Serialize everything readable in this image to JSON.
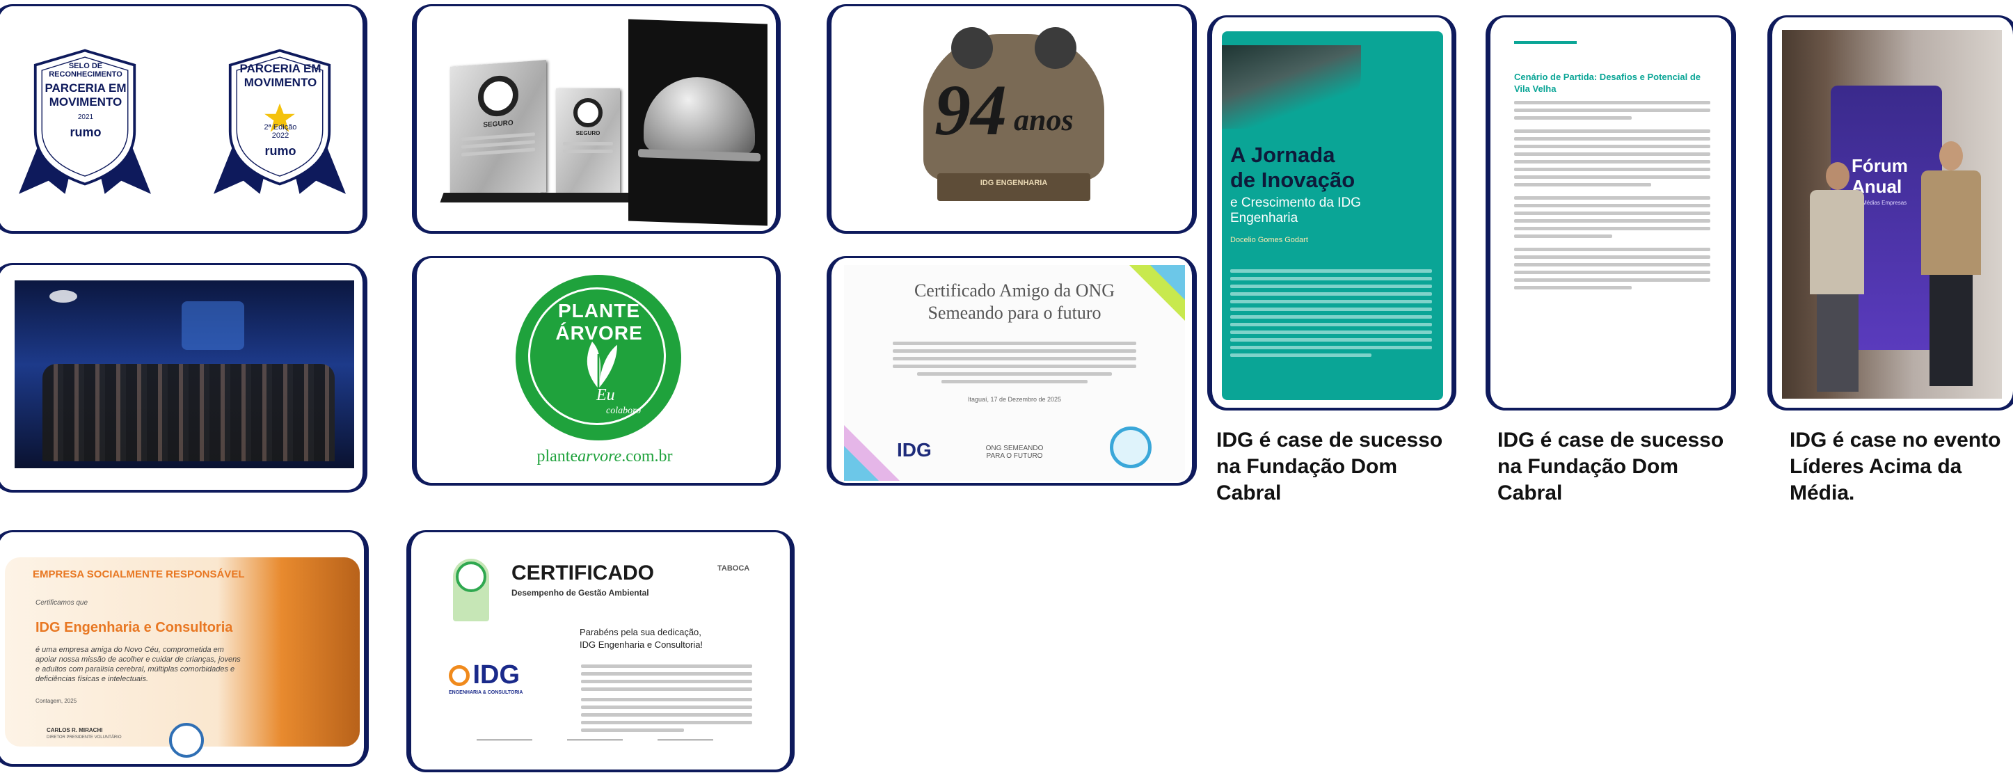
{
  "badges": {
    "left": {
      "line1": "SELO DE",
      "line2": "RECONHECIMENTO",
      "line3": "PARCERIA EM",
      "line4": "MOVIMENTO",
      "year": "2021",
      "brand": "rumo"
    },
    "right": {
      "line1": "PARCERIA EM",
      "line2": "MOVIMENTO",
      "edition": "2ª Edição",
      "year": "2022",
      "brand": "rumo"
    }
  },
  "trophies": {
    "plaque_label": "SEGURO",
    "plaque_label2": "SEGURO"
  },
  "anniversary": {
    "number": "94",
    "suffix": "anos",
    "plate": "IDG ENGENHARIA"
  },
  "plante": {
    "ring_text": "PLANTE ÁRVORE",
    "eu": "Eu",
    "colaboro": "colaboro",
    "url_pre": "plante",
    "url_mid": "arvore",
    "url_post": ".com.br"
  },
  "ong": {
    "title_line1": "Certificado Amigo da ONG",
    "title_line2": "Semeando para o futuro",
    "date": "Itaguaí, 17 de Dezembro de 2025",
    "footer": "ONG SEMEANDO PARA O FUTURO",
    "logo": "IDG"
  },
  "book": {
    "title1": "A Jornada",
    "title2": "de Inovação",
    "sub1": "e Crescimento da IDG",
    "sub2": "Engenharia",
    "author": "Docelio Gomes Godart"
  },
  "article": {
    "heading1": "Cenário de Partida: Desafios e Potencial de",
    "heading2": "Vila Velha"
  },
  "event": {
    "banner1": "Fórum",
    "banner2": "Anual",
    "banner3": "dos Médias Empresas"
  },
  "empresa": {
    "header": "EMPRESA SOCIALMENTE RESPONSÁVEL",
    "certify": "Certificamos que",
    "company": "IDG Engenharia e Consultoria",
    "body": "é uma empresa amiga do Novo Céu, comprometida em apoiar nossa missão de acolher e cuidar de crianças, jovens e adultos com paralisia cerebral, múltiplas comorbidades e deficiências físicas e intelectuais.",
    "place": "Contagem, 2025",
    "signer": "CARLOS R. MIRACHI",
    "signer_role": "DIRETOR PRESIDENTE VOLUNTÁRIO"
  },
  "certificado": {
    "title": "CERTIFICADO",
    "subtitle": "Desempenho de Gestão Ambiental",
    "brand": "TABOCA",
    "congrats1": "Parabéns pela sua dedicação,",
    "congrats2": "IDG Engenharia e Consultoria!",
    "logo": "IDG",
    "logo_sub": "ENGENHARIA & CONSULTORIA"
  },
  "captions": {
    "c1": "IDG é case de sucesso na Fundação Dom Cabral",
    "c2": "IDG é case de sucesso na Fundação Dom Cabral",
    "c3": "IDG é case no evento Líderes Acima da Média."
  },
  "colors": {
    "navy": "#0e1a5c",
    "teal": "#0aa596",
    "green": "#1fa23c",
    "orange": "#e87722"
  }
}
